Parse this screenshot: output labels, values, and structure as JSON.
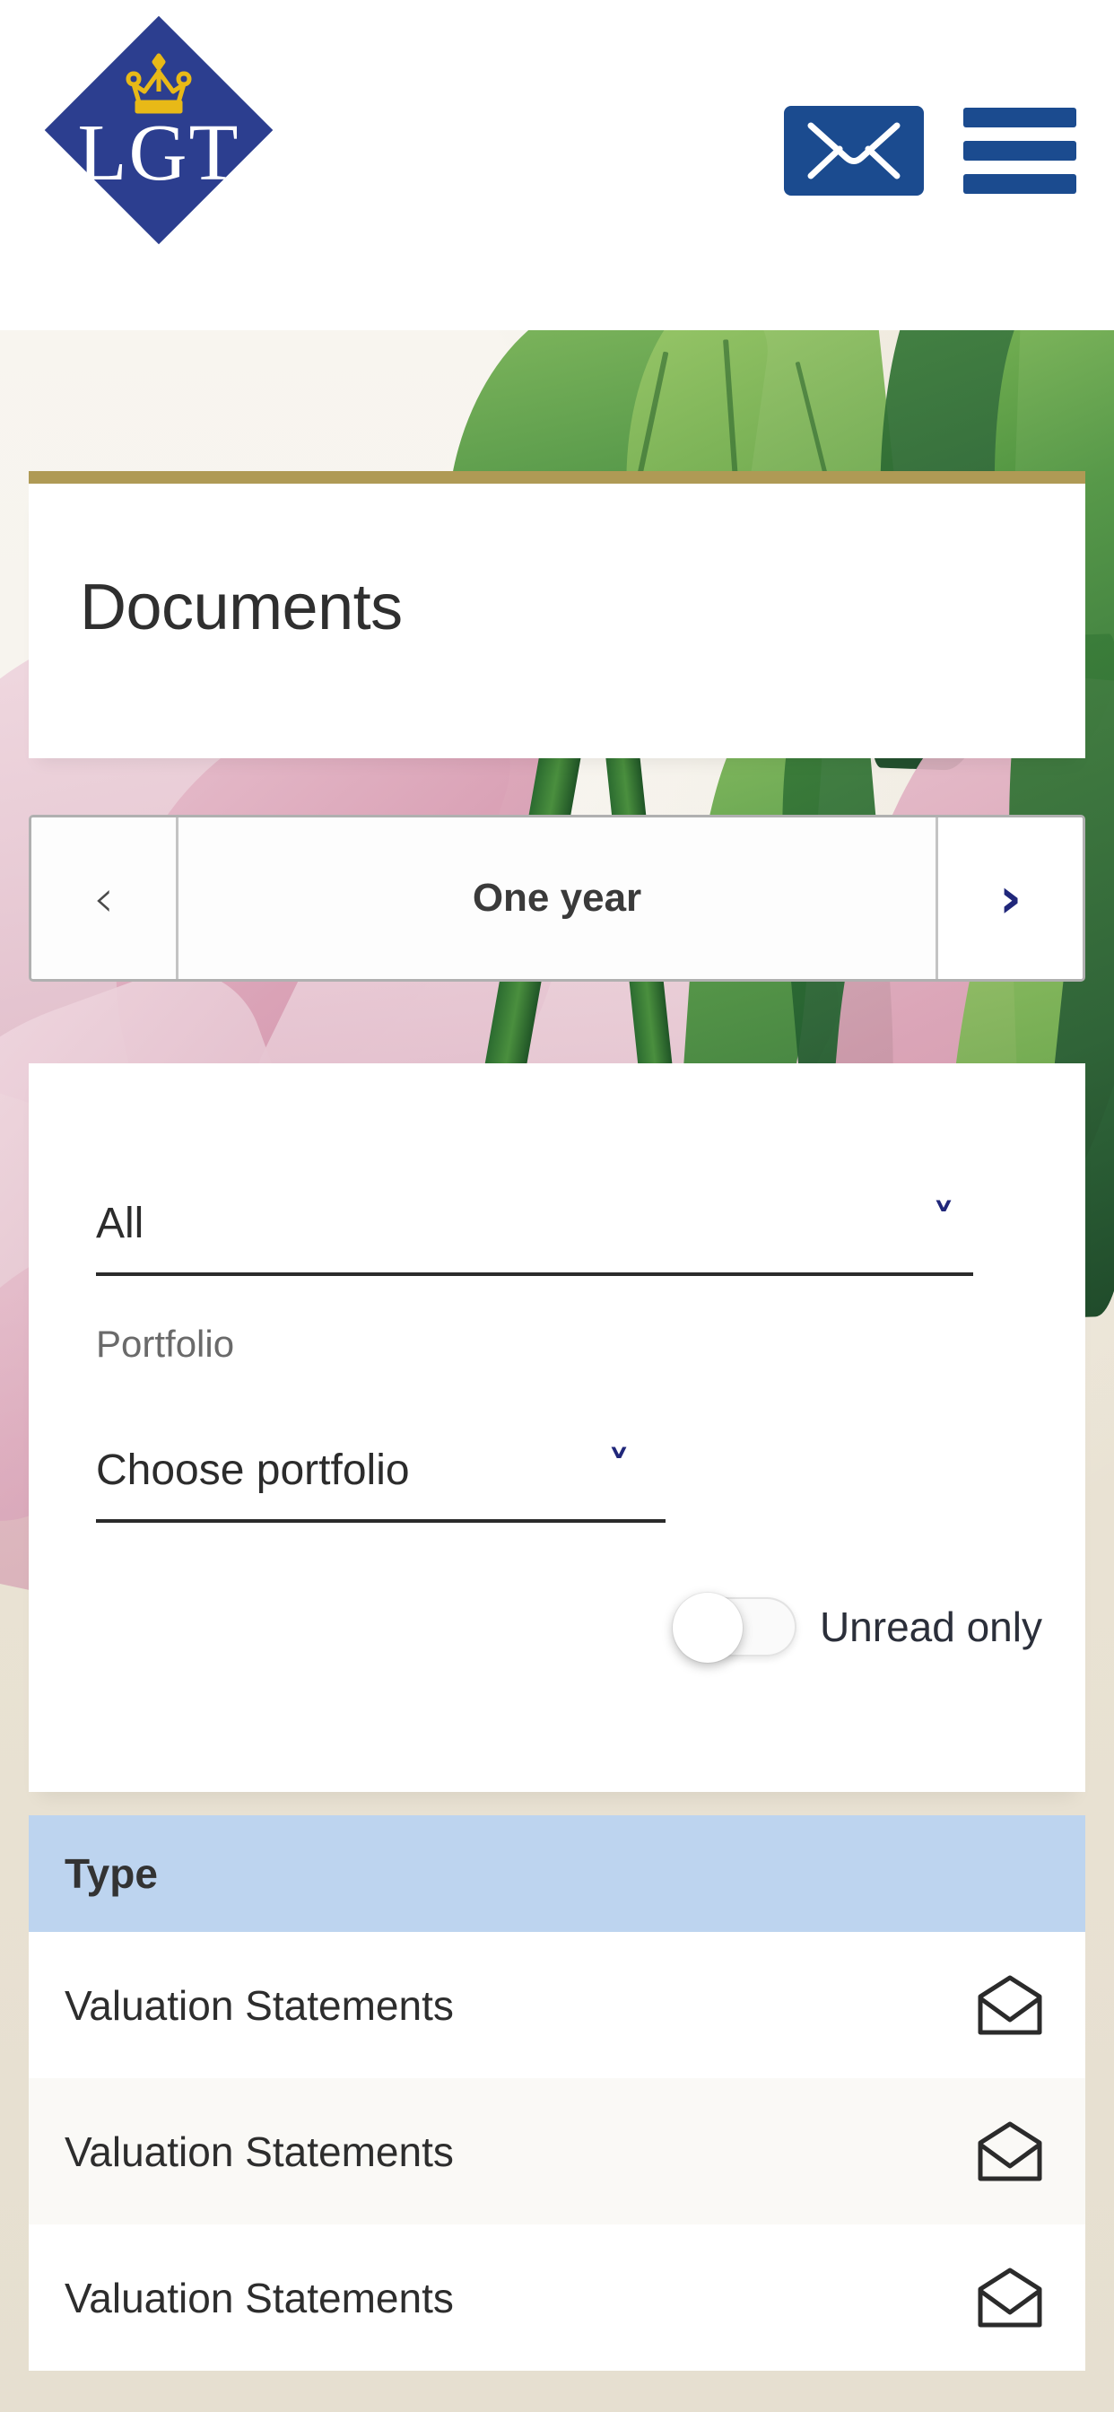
{
  "brand": {
    "logo_text": "LGT",
    "logo_icon": "crown-icon",
    "diamond_color": "#2C3E8F",
    "crown_color": "#E8B917",
    "accent_gold": "#AF9A55",
    "accent_navy": "#20277A"
  },
  "header": {
    "mail_icon": "envelope-icon",
    "menu_icon": "hamburger-menu-icon",
    "mail_bg": "#1B4B8F"
  },
  "page": {
    "title": "Documents"
  },
  "period": {
    "prev_icon": "chevron-left-icon",
    "next_icon": "chevron-right-icon",
    "label": "One year"
  },
  "filters": {
    "category": {
      "value": "All",
      "chevron_icon": "chevron-down-icon"
    },
    "portfolio": {
      "label": "Portfolio",
      "value": "Choose portfolio",
      "chevron_icon": "chevron-down-icon"
    },
    "unread_toggle": {
      "label": "Unread only",
      "state": "off"
    }
  },
  "list": {
    "header": "Type",
    "header_bg": "#BDD4EF",
    "rows": [
      {
        "type": "Valuation Statements",
        "status_icon": "envelope-open-icon"
      },
      {
        "type": "Valuation Statements",
        "status_icon": "envelope-open-icon"
      },
      {
        "type": "Valuation Statements",
        "status_icon": "envelope-open-icon"
      }
    ]
  }
}
